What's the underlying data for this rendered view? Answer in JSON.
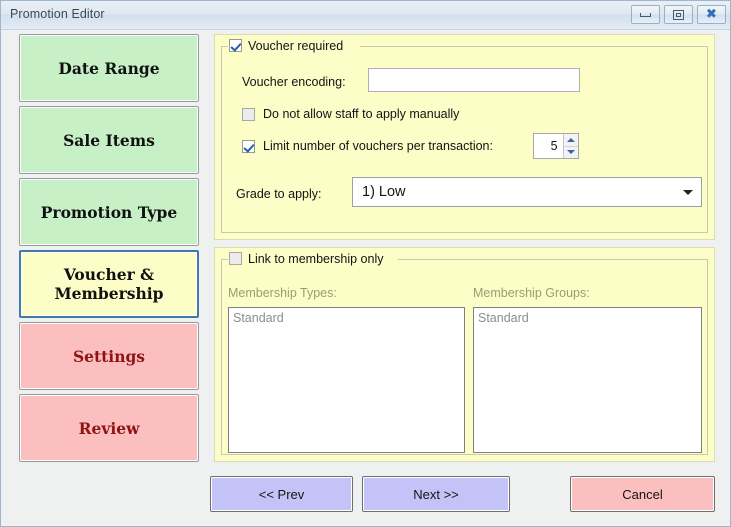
{
  "window": {
    "title": "Promotion Editor",
    "controls": [
      {
        "name": "minimize-button",
        "icon": "minimize-icon"
      },
      {
        "name": "maximize-button",
        "icon": "maximize-icon"
      },
      {
        "name": "close-button",
        "icon": "close-icon",
        "glyph": "✖"
      }
    ]
  },
  "sidebar": {
    "items": [
      {
        "label": "Date Range",
        "state": "complete",
        "color": "#c7f0c7"
      },
      {
        "label": "Sale Items",
        "state": "complete",
        "color": "#c7f0c7"
      },
      {
        "label": "Promotion Type",
        "state": "complete",
        "color": "#c7f0c7"
      },
      {
        "label": "Voucher & Membership",
        "state": "active",
        "color": "#fdfdc8"
      },
      {
        "label": "Settings",
        "state": "pending",
        "color": "#fbbfbf"
      },
      {
        "label": "Review",
        "state": "pending",
        "color": "#fbbfbf"
      }
    ],
    "active_label_line1": "Voucher &",
    "active_label_line2": "Membership"
  },
  "voucher_panel": {
    "group_label": "Voucher required",
    "group_checked": true,
    "encoding_label": "Voucher encoding:",
    "encoding_value": "",
    "encoding_placeholder": "",
    "no_manual_label": "Do not allow staff to apply manually",
    "no_manual_checked": false,
    "limit_label": "Limit number of vouchers per transaction:",
    "limit_checked": true,
    "limit_value": "5",
    "grade_label": "Grade to apply:",
    "grade_value": "1) Low"
  },
  "membership_panel": {
    "group_label": "Link to membership only",
    "group_checked": false,
    "types_label": "Membership Types:",
    "types_items": [
      "Standard"
    ],
    "groups_label": "Membership Groups:",
    "groups_items": [
      "Standard"
    ]
  },
  "footer": {
    "prev_label": "<< Prev",
    "next_label": "Next >>",
    "cancel_label": "Cancel"
  }
}
